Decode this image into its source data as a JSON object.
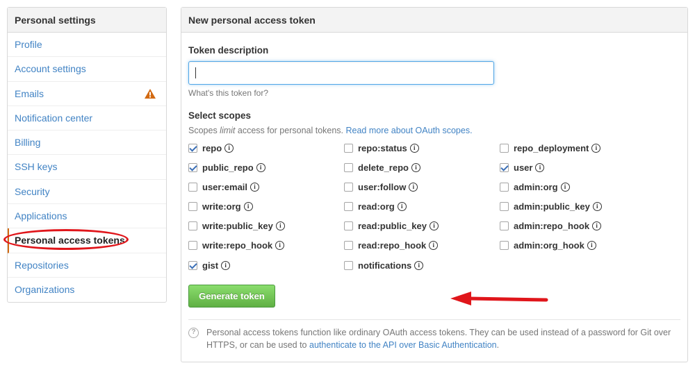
{
  "sidebar": {
    "title": "Personal settings",
    "items": [
      {
        "label": "Profile"
      },
      {
        "label": "Account settings"
      },
      {
        "label": "Emails",
        "warning_icon": "warning-icon"
      },
      {
        "label": "Notification center"
      },
      {
        "label": "Billing"
      },
      {
        "label": "SSH keys"
      },
      {
        "label": "Security"
      },
      {
        "label": "Applications"
      },
      {
        "label": "Personal access tokens",
        "selected": true
      },
      {
        "label": "Repositories"
      },
      {
        "label": "Organizations"
      }
    ]
  },
  "panel": {
    "title": "New personal access token",
    "token_description": {
      "label": "Token description",
      "value": "",
      "hint": "What's this token for?"
    },
    "scopes": {
      "label": "Select scopes",
      "desc_pre": "Scopes ",
      "desc_em": "limit",
      "desc_post": " access for personal tokens. ",
      "link": "Read more about OAuth scopes.",
      "items": [
        {
          "name": "repo",
          "checked": true
        },
        {
          "name": "repo:status",
          "checked": false
        },
        {
          "name": "repo_deployment",
          "checked": false
        },
        {
          "name": "public_repo",
          "checked": true
        },
        {
          "name": "delete_repo",
          "checked": false
        },
        {
          "name": "user",
          "checked": true
        },
        {
          "name": "user:email",
          "checked": false
        },
        {
          "name": "user:follow",
          "checked": false
        },
        {
          "name": "admin:org",
          "checked": false
        },
        {
          "name": "write:org",
          "checked": false
        },
        {
          "name": "read:org",
          "checked": false
        },
        {
          "name": "admin:public_key",
          "checked": false
        },
        {
          "name": "write:public_key",
          "checked": false
        },
        {
          "name": "read:public_key",
          "checked": false
        },
        {
          "name": "admin:repo_hook",
          "checked": false
        },
        {
          "name": "write:repo_hook",
          "checked": false
        },
        {
          "name": "read:repo_hook",
          "checked": false
        },
        {
          "name": "admin:org_hook",
          "checked": false
        },
        {
          "name": "gist",
          "checked": true
        },
        {
          "name": "notifications",
          "checked": false
        }
      ]
    },
    "generate_button": "Generate token",
    "note": {
      "text": "Personal access tokens function like ordinary OAuth access tokens. They can be used instead of a password for Git over HTTPS, or can be used to ",
      "link": "authenticate to the API over Basic Authentication",
      "end": "."
    }
  },
  "colors": {
    "accent_link": "#4183c4",
    "highlight_annotation": "#e0161b",
    "button_green": "#60b044",
    "warning": "#d26911"
  }
}
